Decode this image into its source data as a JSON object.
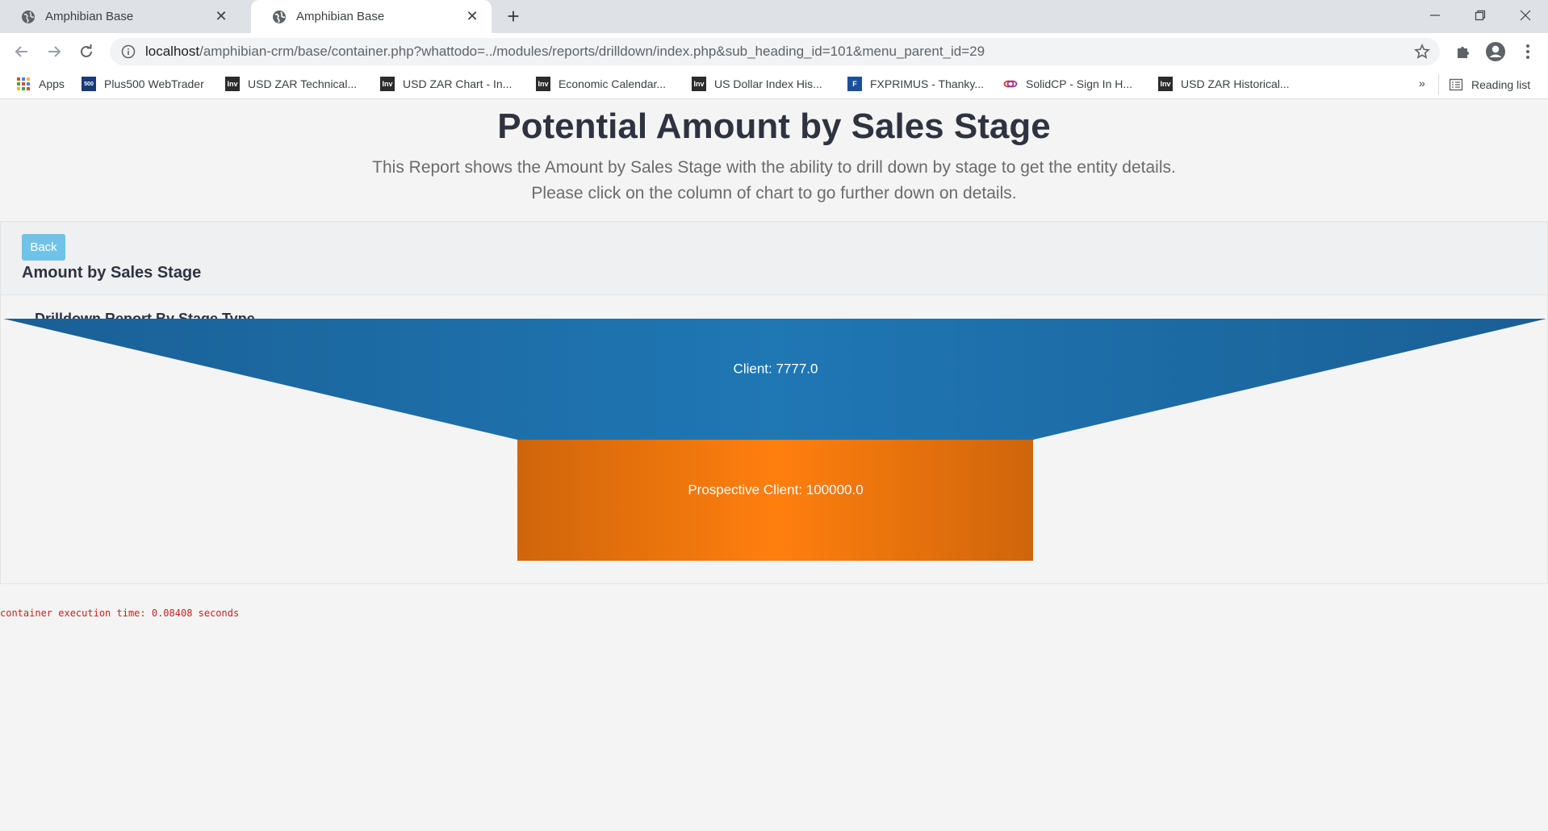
{
  "browser": {
    "tabs": [
      {
        "title": "Amphibian Base",
        "active": false
      },
      {
        "title": "Amphibian Base",
        "active": true
      }
    ],
    "url_host": "localhost",
    "url_rest": "/amphibian-crm/base/container.php?whattodo=../modules/reports/drilldown/index.php&sub_heading_id=101&menu_parent_id=29",
    "bookmarks": [
      {
        "label": "Apps",
        "icon": "apps-grid-icon"
      },
      {
        "label": "Plus500 WebTrader",
        "icon": "plus500-icon"
      },
      {
        "label": "USD ZAR Technical...",
        "icon": "investing-icon"
      },
      {
        "label": "USD ZAR Chart - In...",
        "icon": "investing-icon"
      },
      {
        "label": "Economic Calendar...",
        "icon": "investing-icon"
      },
      {
        "label": "US Dollar Index His...",
        "icon": "investing-icon"
      },
      {
        "label": "FXPRIMUS - Thanky...",
        "icon": "fxprimus-icon"
      },
      {
        "label": "SolidCP - Sign In H...",
        "icon": "solidcp-icon"
      },
      {
        "label": "USD ZAR Historical...",
        "icon": "investing-icon"
      }
    ],
    "bookmarks_overflow": "»",
    "reading_list": "Reading list"
  },
  "page": {
    "heading": "Potential Amount by Sales Stage",
    "description_line1": "This Report shows the Amount by Sales Stage with the ability to drill down by stage to get the entity details.",
    "description_line2": "Please click on the column of chart to go further down on details.",
    "back_label": "Back",
    "panel_title": "Amount by Sales Stage",
    "exec_time": "container execution time: 0.08408 seconds"
  },
  "chart_data": {
    "type": "funnel",
    "title": "Drilldown Report By Stage Type",
    "segments": [
      {
        "name": "Client",
        "value": 7777.0,
        "label": "Client: 7777.0",
        "color": "#1f77b4"
      },
      {
        "name": "Prospective Client",
        "value": 100000.0,
        "label": "Prospective Client: 100000.0",
        "color": "#ff7f0e"
      }
    ]
  },
  "colors": {
    "back_button": "#6fc3e8",
    "exec_time": "#cc1f1f"
  }
}
